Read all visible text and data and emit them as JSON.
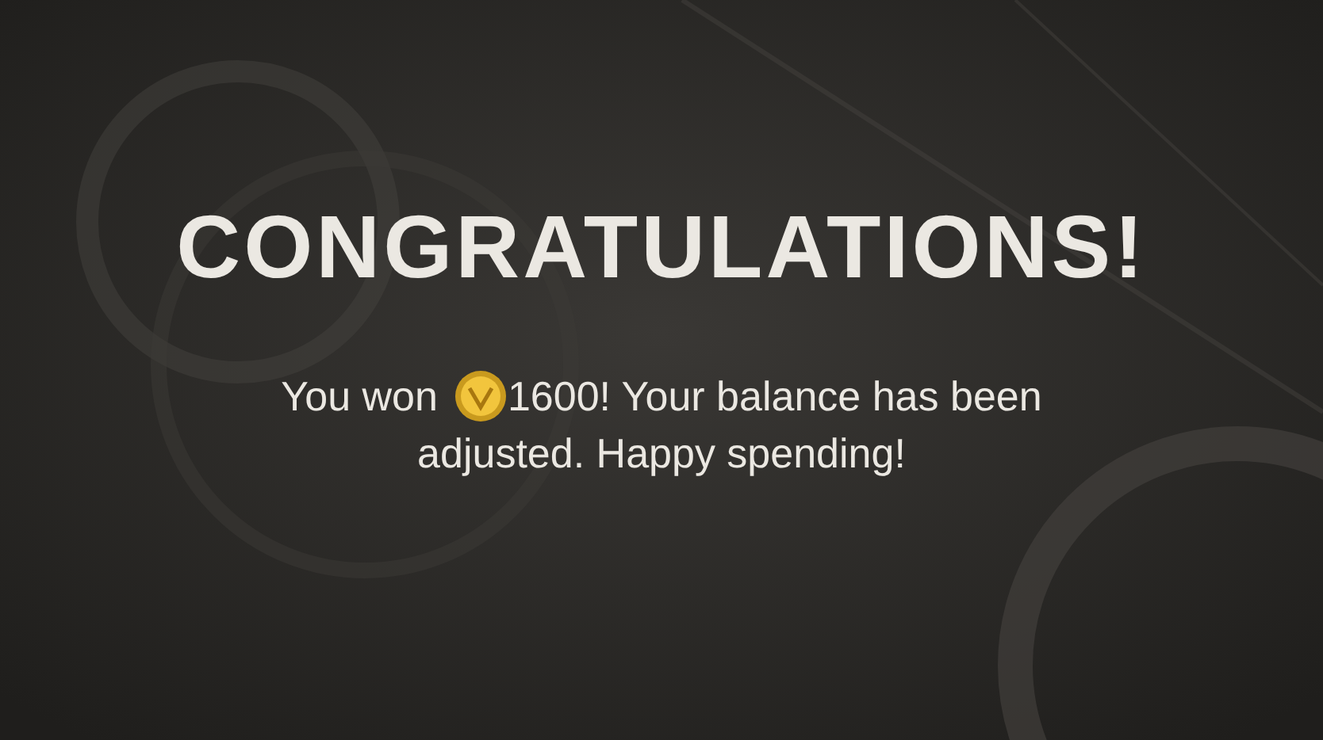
{
  "title": "CONGRATULATIONS!",
  "message": {
    "lead": "You won",
    "amount_line": "1600! Your balance has been",
    "second_line": "adjusted. Happy spending!"
  }
}
